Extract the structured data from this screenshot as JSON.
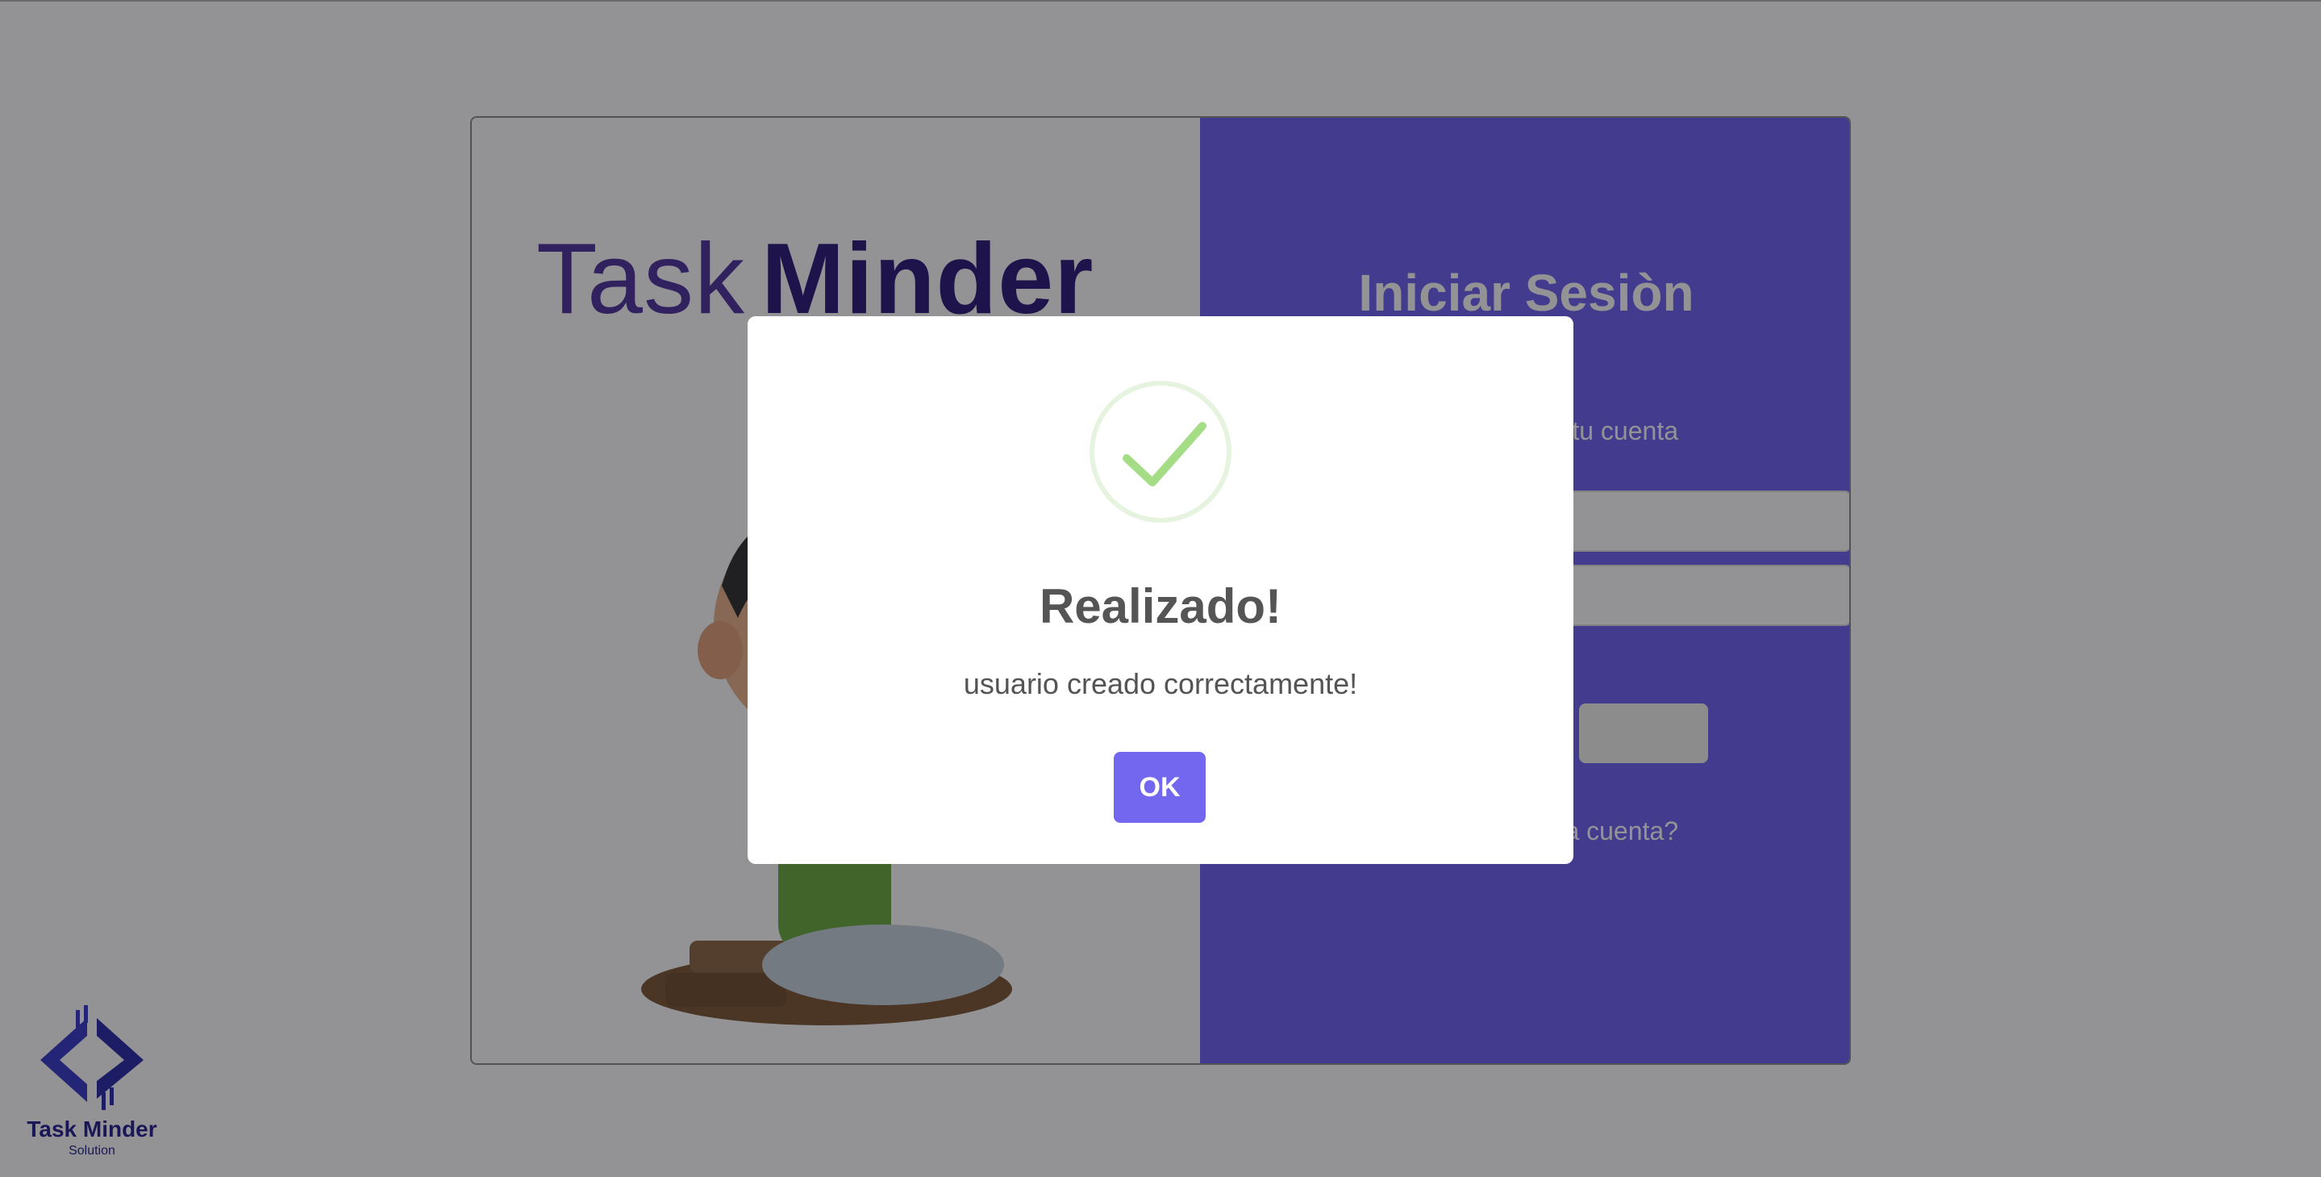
{
  "login_card": {
    "brand": {
      "word1": "Task",
      "word2": "Minder"
    },
    "title": "Iniciar Sesiòn",
    "subtitle_partial": "tu cuenta",
    "link_partial": "a cuenta?"
  },
  "corner_logo": {
    "name": "Task Minder",
    "subtitle": "Solution"
  },
  "modal": {
    "icon": "success-check-icon",
    "title": "Realizado!",
    "text": "usuario creado correctamente!",
    "confirm_label": "OK"
  },
  "colors": {
    "accent": "#7367f0",
    "panel": "#6b5ff2",
    "brand_dark": "#2a1378",
    "success": "#a5dc86"
  }
}
